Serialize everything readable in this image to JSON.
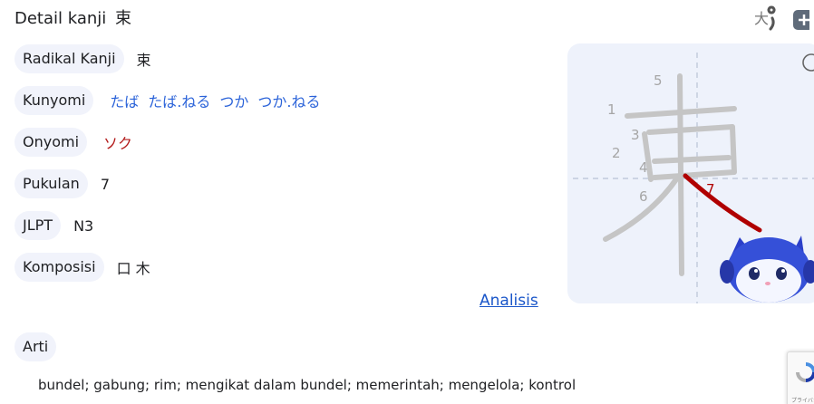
{
  "header": {
    "title": "Detail kanji",
    "kanji": "束"
  },
  "top_icons": [
    {
      "name": "text-size-icon",
      "glyph": "大"
    }
  ],
  "details": {
    "radikal": {
      "label": "Radikal Kanji",
      "value": "束"
    },
    "kunyomi": {
      "label": "Kunyomi",
      "values": [
        "たば",
        "たば.ねる",
        "つか",
        "つか.ねる"
      ]
    },
    "onyomi": {
      "label": "Onyomi",
      "value": "ソク"
    },
    "pukulan": {
      "label": "Pukulan",
      "value": "7"
    },
    "jlpt": {
      "label": "JLPT",
      "value": "N3"
    },
    "komposisi": {
      "label": "Komposisi",
      "value": "口 木"
    }
  },
  "analisis_link": "Analisis",
  "arti": {
    "label": "Arti",
    "text": "bundel; gabung; rim; mengikat dalam bundel; memerintah; mengelola; kontrol"
  },
  "stroke_numbers": [
    "1",
    "2",
    "3",
    "4",
    "5",
    "6",
    "7"
  ],
  "colors": {
    "accent_blue": "#2b63d9",
    "onyomi_red": "#b31b1b",
    "active_stroke": "#b00000",
    "pill_bg": "#f1f3fb"
  },
  "recaptcha": {
    "privacy_text": "プライバシー"
  }
}
